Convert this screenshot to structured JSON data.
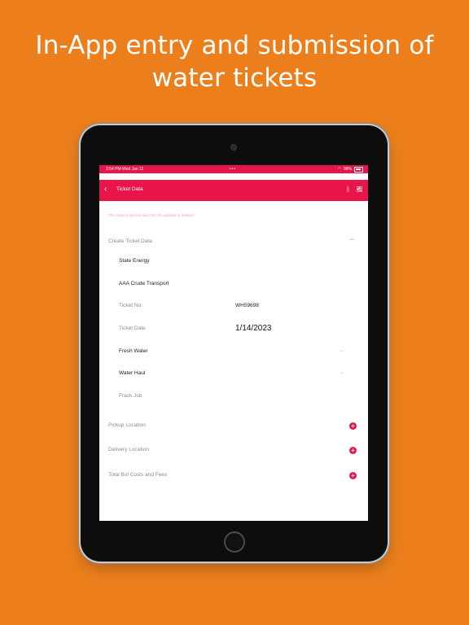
{
  "headline": {
    "line1": "In-App entry and submission of",
    "line2": "water tickets"
  },
  "status_bar": {
    "time": "2:54 PM",
    "date": "Wed Jan 11",
    "dots": "•••",
    "battery": "98%"
  },
  "nav": {
    "back_icon": "chevron-left-icon",
    "title": "Ticket Data",
    "bluetooth_icon": "bluetooth-icon",
    "qr_icon": "qr-code-icon"
  },
  "notice": "This ticket is synced and can't be updated or deleted",
  "section": {
    "title": "Create Ticket Data",
    "collapse_symbol": "−"
  },
  "fields": {
    "company": "State Energy",
    "transport": "AAA Crude Transport",
    "ticket_no_label": "Ticket No:",
    "ticket_no_value": "WH59698",
    "ticket_date_label": "Ticket Date",
    "ticket_date_value": "1/14/2023",
    "fresh_water": "Fresh Water",
    "water_haul": "Water Haul",
    "frack_job": "Frack Job"
  },
  "expanders": {
    "pickup": "Pickup Location",
    "delivery": "Delivery Location",
    "costs": "Total Bol Costs and Fees",
    "plus_symbol": "+"
  },
  "colors": {
    "background": "#EC7F1C",
    "accent": "#E8154A"
  }
}
